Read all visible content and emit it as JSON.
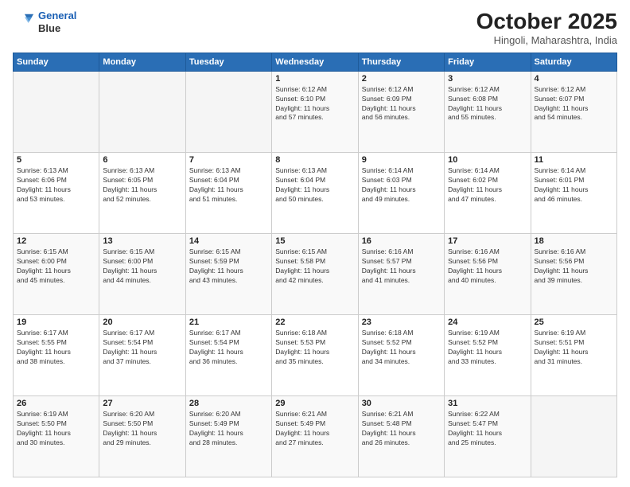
{
  "header": {
    "logo_line1": "General",
    "logo_line2": "Blue",
    "title": "October 2025",
    "subtitle": "Hingoli, Maharashtra, India"
  },
  "days_of_week": [
    "Sunday",
    "Monday",
    "Tuesday",
    "Wednesday",
    "Thursday",
    "Friday",
    "Saturday"
  ],
  "weeks": [
    [
      {
        "day": "",
        "info": ""
      },
      {
        "day": "",
        "info": ""
      },
      {
        "day": "",
        "info": ""
      },
      {
        "day": "1",
        "info": "Sunrise: 6:12 AM\nSunset: 6:10 PM\nDaylight: 11 hours\nand 57 minutes."
      },
      {
        "day": "2",
        "info": "Sunrise: 6:12 AM\nSunset: 6:09 PM\nDaylight: 11 hours\nand 56 minutes."
      },
      {
        "day": "3",
        "info": "Sunrise: 6:12 AM\nSunset: 6:08 PM\nDaylight: 11 hours\nand 55 minutes."
      },
      {
        "day": "4",
        "info": "Sunrise: 6:12 AM\nSunset: 6:07 PM\nDaylight: 11 hours\nand 54 minutes."
      }
    ],
    [
      {
        "day": "5",
        "info": "Sunrise: 6:13 AM\nSunset: 6:06 PM\nDaylight: 11 hours\nand 53 minutes."
      },
      {
        "day": "6",
        "info": "Sunrise: 6:13 AM\nSunset: 6:05 PM\nDaylight: 11 hours\nand 52 minutes."
      },
      {
        "day": "7",
        "info": "Sunrise: 6:13 AM\nSunset: 6:04 PM\nDaylight: 11 hours\nand 51 minutes."
      },
      {
        "day": "8",
        "info": "Sunrise: 6:13 AM\nSunset: 6:04 PM\nDaylight: 11 hours\nand 50 minutes."
      },
      {
        "day": "9",
        "info": "Sunrise: 6:14 AM\nSunset: 6:03 PM\nDaylight: 11 hours\nand 49 minutes."
      },
      {
        "day": "10",
        "info": "Sunrise: 6:14 AM\nSunset: 6:02 PM\nDaylight: 11 hours\nand 47 minutes."
      },
      {
        "day": "11",
        "info": "Sunrise: 6:14 AM\nSunset: 6:01 PM\nDaylight: 11 hours\nand 46 minutes."
      }
    ],
    [
      {
        "day": "12",
        "info": "Sunrise: 6:15 AM\nSunset: 6:00 PM\nDaylight: 11 hours\nand 45 minutes."
      },
      {
        "day": "13",
        "info": "Sunrise: 6:15 AM\nSunset: 6:00 PM\nDaylight: 11 hours\nand 44 minutes."
      },
      {
        "day": "14",
        "info": "Sunrise: 6:15 AM\nSunset: 5:59 PM\nDaylight: 11 hours\nand 43 minutes."
      },
      {
        "day": "15",
        "info": "Sunrise: 6:15 AM\nSunset: 5:58 PM\nDaylight: 11 hours\nand 42 minutes."
      },
      {
        "day": "16",
        "info": "Sunrise: 6:16 AM\nSunset: 5:57 PM\nDaylight: 11 hours\nand 41 minutes."
      },
      {
        "day": "17",
        "info": "Sunrise: 6:16 AM\nSunset: 5:56 PM\nDaylight: 11 hours\nand 40 minutes."
      },
      {
        "day": "18",
        "info": "Sunrise: 6:16 AM\nSunset: 5:56 PM\nDaylight: 11 hours\nand 39 minutes."
      }
    ],
    [
      {
        "day": "19",
        "info": "Sunrise: 6:17 AM\nSunset: 5:55 PM\nDaylight: 11 hours\nand 38 minutes."
      },
      {
        "day": "20",
        "info": "Sunrise: 6:17 AM\nSunset: 5:54 PM\nDaylight: 11 hours\nand 37 minutes."
      },
      {
        "day": "21",
        "info": "Sunrise: 6:17 AM\nSunset: 5:54 PM\nDaylight: 11 hours\nand 36 minutes."
      },
      {
        "day": "22",
        "info": "Sunrise: 6:18 AM\nSunset: 5:53 PM\nDaylight: 11 hours\nand 35 minutes."
      },
      {
        "day": "23",
        "info": "Sunrise: 6:18 AM\nSunset: 5:52 PM\nDaylight: 11 hours\nand 34 minutes."
      },
      {
        "day": "24",
        "info": "Sunrise: 6:19 AM\nSunset: 5:52 PM\nDaylight: 11 hours\nand 33 minutes."
      },
      {
        "day": "25",
        "info": "Sunrise: 6:19 AM\nSunset: 5:51 PM\nDaylight: 11 hours\nand 31 minutes."
      }
    ],
    [
      {
        "day": "26",
        "info": "Sunrise: 6:19 AM\nSunset: 5:50 PM\nDaylight: 11 hours\nand 30 minutes."
      },
      {
        "day": "27",
        "info": "Sunrise: 6:20 AM\nSunset: 5:50 PM\nDaylight: 11 hours\nand 29 minutes."
      },
      {
        "day": "28",
        "info": "Sunrise: 6:20 AM\nSunset: 5:49 PM\nDaylight: 11 hours\nand 28 minutes."
      },
      {
        "day": "29",
        "info": "Sunrise: 6:21 AM\nSunset: 5:49 PM\nDaylight: 11 hours\nand 27 minutes."
      },
      {
        "day": "30",
        "info": "Sunrise: 6:21 AM\nSunset: 5:48 PM\nDaylight: 11 hours\nand 26 minutes."
      },
      {
        "day": "31",
        "info": "Sunrise: 6:22 AM\nSunset: 5:47 PM\nDaylight: 11 hours\nand 25 minutes."
      },
      {
        "day": "",
        "info": ""
      }
    ]
  ]
}
